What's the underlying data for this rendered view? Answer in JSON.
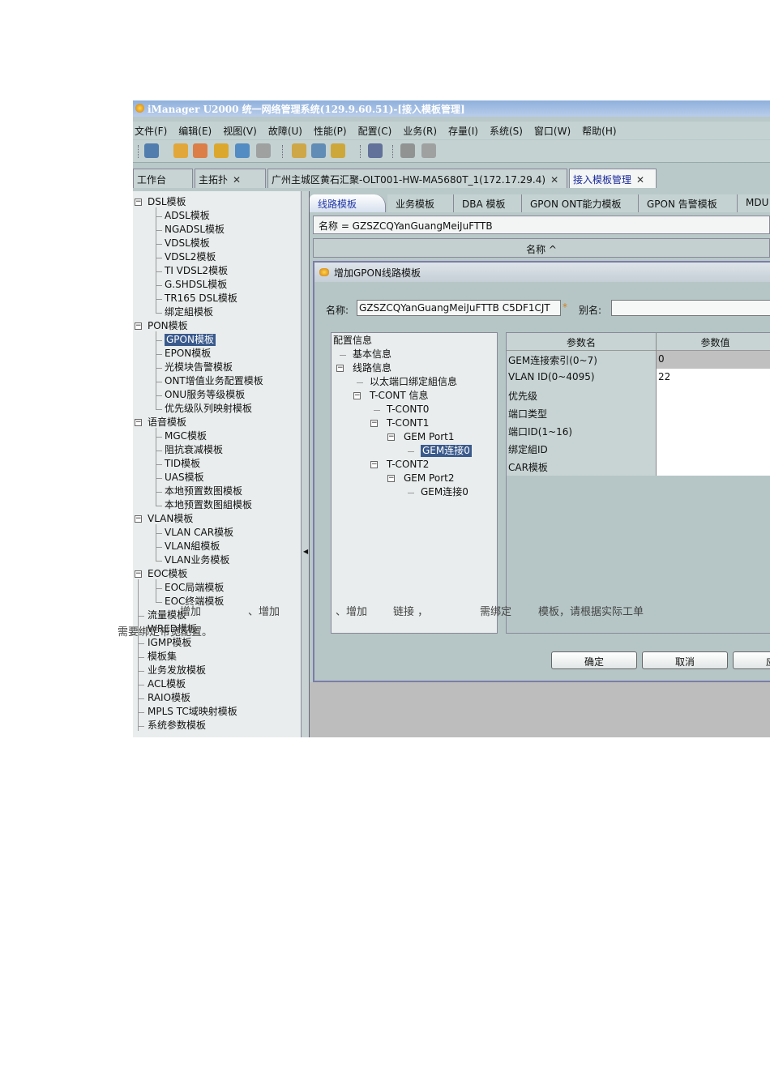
{
  "window": {
    "title": "iManager U2000 统一网络管理系统(129.9.60.51)-[接入模板管理]"
  },
  "menu": [
    "文件(F)",
    "编辑(E)",
    "视图(V)",
    "故障(U)",
    "性能(P)",
    "配置(C)",
    "业务(R)",
    "存量(I)",
    "系统(S)",
    "窗口(W)",
    "帮助(H)"
  ],
  "toolbar_icons": [
    "new-topology-icon",
    "logout-icon",
    "lock-cancel-icon",
    "lock-icon",
    "switch-user-icon",
    "user-icon",
    "alarm-doc-icon",
    "alarm-search-icon",
    "mute-icon",
    "topology-icon",
    "tools-icon",
    "link-icon"
  ],
  "tabs": [
    {
      "label": "工作台",
      "closable": false
    },
    {
      "label": "主拓扑",
      "closable": true
    },
    {
      "label": "广州主城区黄石汇聚-OLT001-HW-MA5680T_1(172.17.29.4)",
      "closable": true
    },
    {
      "label": "接入模板管理",
      "closable": true,
      "active": true
    }
  ],
  "tree": [
    {
      "label": "DSL模板",
      "level": 0,
      "expanded": true
    },
    {
      "label": "ADSL模板",
      "level": 1
    },
    {
      "label": "NGADSL模板",
      "level": 1
    },
    {
      "label": "VDSL模板",
      "level": 1
    },
    {
      "label": "VDSL2模板",
      "level": 1
    },
    {
      "label": "TI VDSL2模板",
      "level": 1
    },
    {
      "label": "G.SHDSL模板",
      "level": 1
    },
    {
      "label": "TR165 DSL模板",
      "level": 1
    },
    {
      "label": "绑定組模板",
      "level": 1
    },
    {
      "label": "PON模板",
      "level": 0,
      "expanded": true
    },
    {
      "label": "GPON模板",
      "level": 1,
      "selected": true
    },
    {
      "label": "EPON模板",
      "level": 1
    },
    {
      "label": "光模块告警模板",
      "level": 1
    },
    {
      "label": "ONT增值业务配置模板",
      "level": 1
    },
    {
      "label": "ONU服务等级模板",
      "level": 1
    },
    {
      "label": "优先级队列映射模板",
      "level": 1
    },
    {
      "label": "语音模板",
      "level": 0,
      "expanded": true
    },
    {
      "label": "MGC模板",
      "level": 1
    },
    {
      "label": "阻抗衰减模板",
      "level": 1
    },
    {
      "label": "TID模板",
      "level": 1
    },
    {
      "label": "UAS模板",
      "level": 1
    },
    {
      "label": "本地预置数图模板",
      "level": 1
    },
    {
      "label": "本地预置数图組模板",
      "level": 1
    },
    {
      "label": "VLAN模板",
      "level": 0,
      "expanded": true
    },
    {
      "label": "VLAN CAR模板",
      "level": 1
    },
    {
      "label": "VLAN組模板",
      "level": 1
    },
    {
      "label": "VLAN业务模板",
      "level": 1
    },
    {
      "label": "EOC模板",
      "level": 0,
      "expanded": true
    },
    {
      "label": "EOC局端模板",
      "level": 1
    },
    {
      "label": "EOC终端模板",
      "level": 1
    },
    {
      "label": "流量模板",
      "level": 0
    },
    {
      "label": "WRED模板",
      "level": 0
    },
    {
      "label": "IGMP模板",
      "level": 0
    },
    {
      "label": "模板集",
      "level": 0
    },
    {
      "label": "业务发放模板",
      "level": 0
    },
    {
      "label": "ACL模板",
      "level": 0
    },
    {
      "label": "RAIO模板",
      "level": 0
    },
    {
      "label": "MPLS TC域映射模板",
      "level": 0
    },
    {
      "label": "系统参数模板",
      "level": 0
    }
  ],
  "template_tabs": [
    "线路模板",
    "业务模板",
    "DBA 模板",
    "GPON ONT能力模板",
    "GPON 告警模板",
    "MDU"
  ],
  "filter": "名称 = GZSZCQYanGuangMeiJuFTTB",
  "column_header": "名称 ^",
  "dialog": {
    "title": "增加GPON线路模板",
    "name_label": "名称:",
    "name_value": "GZSZCQYanGuangMeiJuFTTB C5DF1CJT",
    "required_mark": "*",
    "alias_label": "别名:",
    "alias_value": "",
    "config_tree": [
      {
        "label": "配置信息",
        "level": 0
      },
      {
        "label": "基本信息",
        "level": 1
      },
      {
        "label": "线路信息",
        "level": 1,
        "expanded": true
      },
      {
        "label": "以太端口绑定組信息",
        "level": 2
      },
      {
        "label": "T-CONT 信息",
        "level": 2,
        "expanded": true
      },
      {
        "label": "T-CONT0",
        "level": 3
      },
      {
        "label": "T-CONT1",
        "level": 3,
        "expanded": true
      },
      {
        "label": "GEM Port1",
        "level": 4,
        "expanded": true
      },
      {
        "label": "GEM连接0",
        "level": 5,
        "selected": true
      },
      {
        "label": "T-CONT2",
        "level": 3,
        "expanded": true
      },
      {
        "label": "GEM Port2",
        "level": 4,
        "expanded": true
      },
      {
        "label": "GEM连接0",
        "level": 5
      }
    ],
    "table_headers": [
      "参数名",
      "参数值"
    ],
    "params": [
      {
        "name": "GEM连接索引(0~7)",
        "value": "0",
        "readonly": true
      },
      {
        "name": "VLAN ID(0~4095)",
        "value": "22"
      },
      {
        "name": "优先级",
        "value": ""
      },
      {
        "name": "端口类型",
        "value": ""
      },
      {
        "name": "端口ID(1~16)",
        "value": ""
      },
      {
        "name": "绑定組ID",
        "value": ""
      },
      {
        "name": "CAR模板",
        "value": ""
      }
    ],
    "buttons": [
      "确定",
      "取消",
      "应用"
    ]
  },
  "overlay_text": [
    "增加",
    "、增加",
    "需要绑定带宽配置。",
    "、增加",
    "链接 ，",
    "需绑定",
    "模板，请根据实际工单"
  ]
}
